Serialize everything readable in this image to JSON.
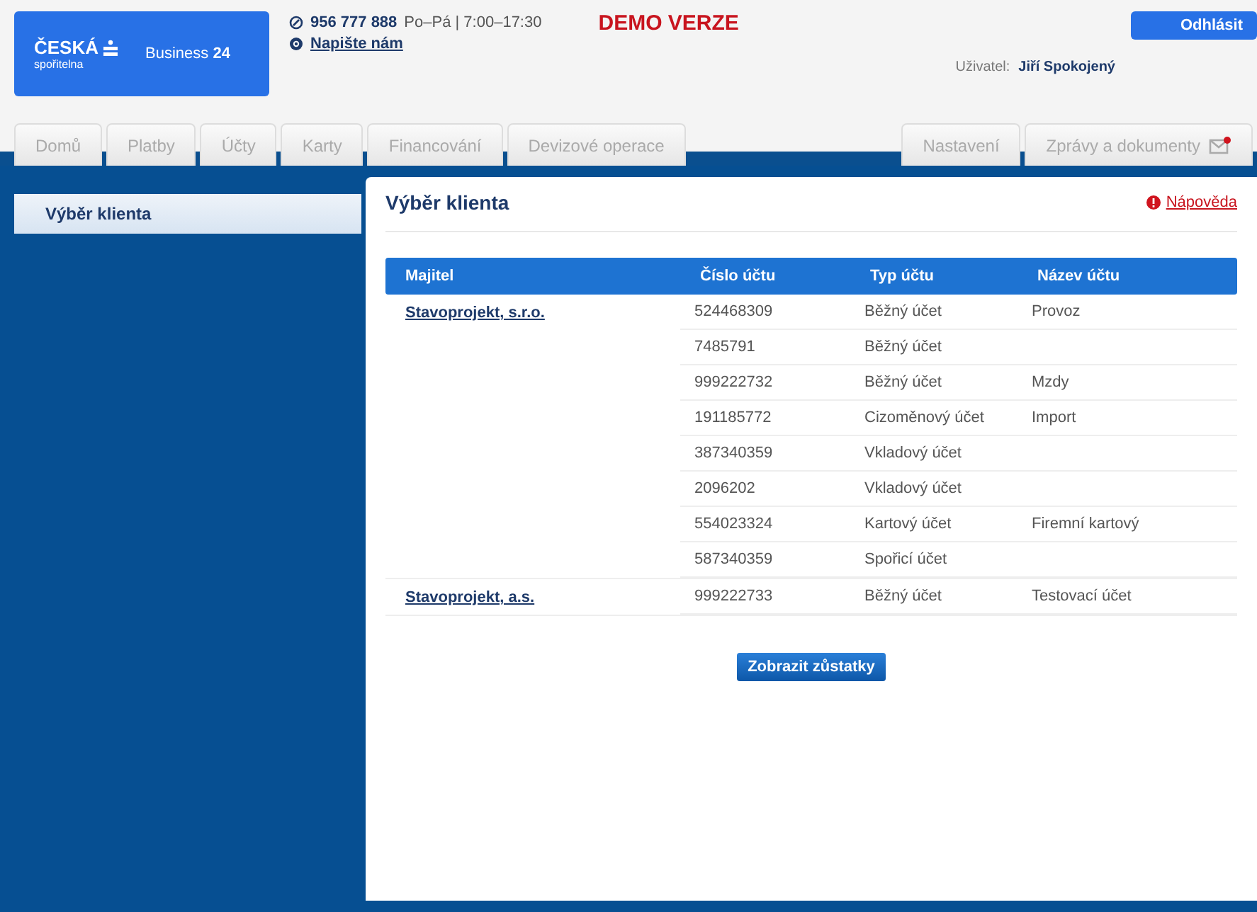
{
  "header": {
    "logo": {
      "brand": "ČESKÁ",
      "sub": "spořitelna",
      "product": "Business",
      "product_num": "24"
    },
    "phone": "956 777 888",
    "hours": "Po–Pá | 7:00–17:30",
    "email_link": "Napište nám",
    "demo": "DEMO VERZE",
    "logout": "Odhlásit",
    "user_label": "Uživatel:",
    "user_name": "Jiří Spokojený"
  },
  "tabs_left": [
    "Domů",
    "Platby",
    "Účty",
    "Karty",
    "Financování",
    "Devizové operace"
  ],
  "tabs_right": [
    {
      "label": "Nastavení",
      "kind": "plain"
    },
    {
      "label": "Zprávy a dokumenty",
      "kind": "mail"
    }
  ],
  "sidebar": {
    "items": [
      {
        "label": "Výběr klienta",
        "selected": true
      }
    ]
  },
  "content": {
    "title": "Výběr klienta",
    "help": "Nápověda",
    "table": {
      "columns": [
        "Majitel",
        "Číslo účtu",
        "Typ účtu",
        "Název účtu"
      ],
      "groups": [
        {
          "owner": "Stavoprojekt, s.r.o.",
          "accounts": [
            {
              "number": "524468309",
              "type": "Běžný účet",
              "name": "Provoz"
            },
            {
              "number": "7485791",
              "type": "Běžný účet"
            },
            {
              "number": "999222732",
              "type": "Běžný účet",
              "name": "Mzdy"
            },
            {
              "number": "191185772",
              "type": "Cizoměnový účet",
              "name": "Import"
            },
            {
              "number": "387340359",
              "type": "Vkladový účet"
            },
            {
              "number": "2096202",
              "type": "Vkladový účet"
            },
            {
              "number": "554023324",
              "type": "Kartový účet",
              "name": "Firemní kartový"
            },
            {
              "number": "587340359",
              "type": "Spořicí účet"
            }
          ]
        },
        {
          "owner": "Stavoprojekt, a.s.",
          "accounts": [
            {
              "number": "999222733",
              "type": "Běžný účet",
              "name": "Testovací účet"
            }
          ]
        }
      ]
    },
    "button": "Zobrazit zůstatky"
  }
}
